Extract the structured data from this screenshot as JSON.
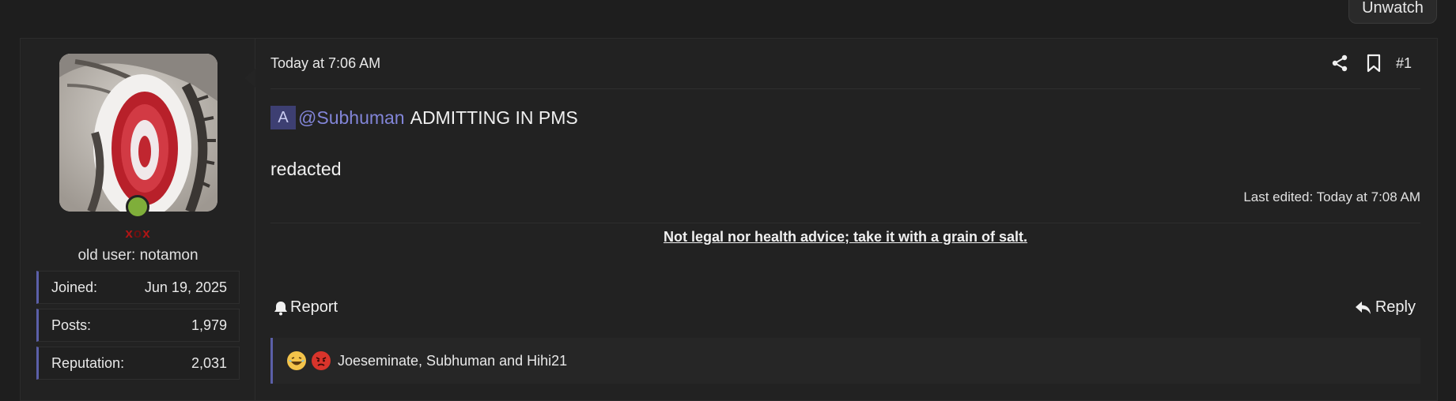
{
  "thread": {
    "watch_label": "Unwatch"
  },
  "post": {
    "author": {
      "username_part1": "x",
      "username_part2": "o",
      "username_part3": "x",
      "user_title": "old user: notamon",
      "stats": [
        {
          "label": "Joined:",
          "value": "Jun 19, 2025"
        },
        {
          "label": "Posts:",
          "value": "1,979"
        },
        {
          "label": "Reputation:",
          "value": "2,031"
        }
      ]
    },
    "timestamp": "Today at 7:06 AM",
    "post_number": "#1",
    "body": {
      "badge": "A",
      "mention": "@Subhuman",
      "line1_text": "ADMITTING IN PMS",
      "line2_text": "redacted"
    },
    "last_edited": "Last edited: Today at 7:08 AM",
    "signature": "Not legal nor health advice; take it with a grain of salt.",
    "actions": {
      "report_label": "Report",
      "reply_label": "Reply"
    },
    "reactions": {
      "icons": [
        "laughing-emoji",
        "angry-emoji"
      ],
      "users_text": "Joeseminate, Subhuman and Hihi21"
    }
  },
  "colors": {
    "accent": "#5b5fa8",
    "mention": "#8285d8",
    "online": "#7fae3a",
    "background": "#1e1e1e"
  }
}
